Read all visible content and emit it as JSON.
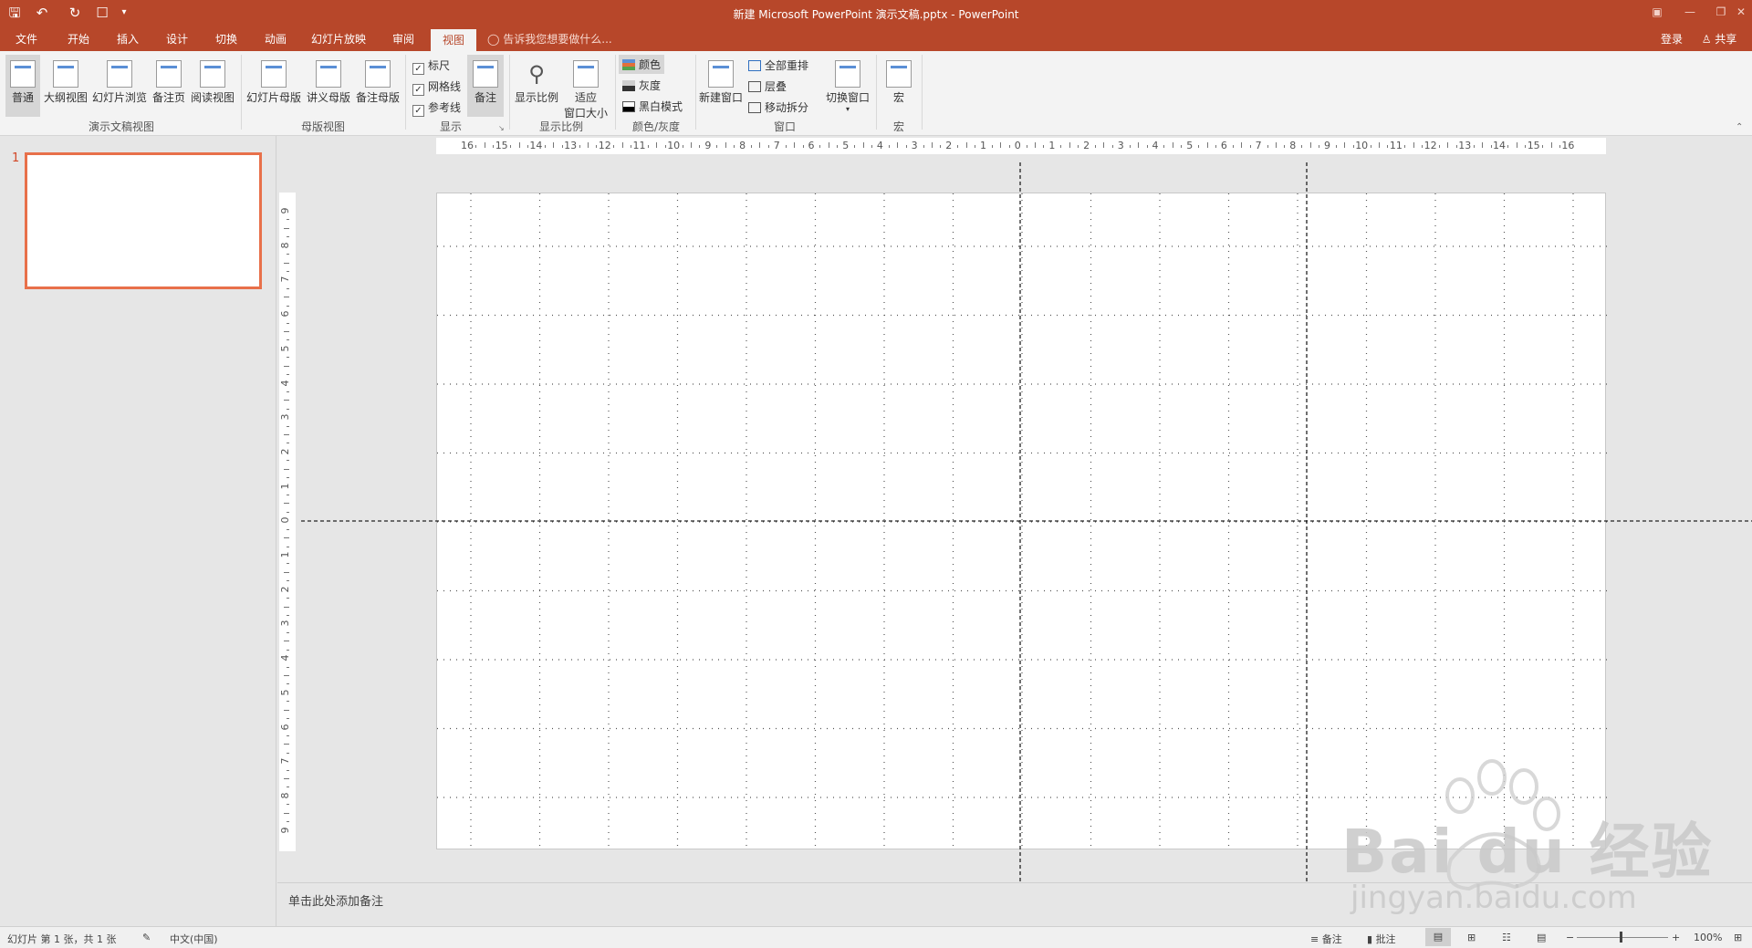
{
  "window": {
    "title": "新建 Microsoft PowerPoint 演示文稿.pptx - PowerPoint"
  },
  "tabs": [
    "文件",
    "开始",
    "插入",
    "设计",
    "切换",
    "动画",
    "幻灯片放映",
    "审阅",
    "视图"
  ],
  "active_tab": "视图",
  "tell_me": "告诉我您想要做什么...",
  "account": {
    "login": "登录",
    "share": "共享"
  },
  "ribbon": {
    "presentation_views": {
      "label": "演示文稿视图",
      "buttons": [
        "普通",
        "大纲视图",
        "幻灯片浏览",
        "备注页",
        "阅读视图"
      ]
    },
    "master_views": {
      "label": "母版视图",
      "buttons": [
        "幻灯片母版",
        "讲义母版",
        "备注母版"
      ]
    },
    "show": {
      "label": "显示",
      "checkboxes": [
        {
          "label": "标尺",
          "checked": true
        },
        {
          "label": "网格线",
          "checked": true
        },
        {
          "label": "参考线",
          "checked": true
        }
      ],
      "notes_button": "备注"
    },
    "zoom": {
      "label": "显示比例",
      "zoom_button": "显示比例",
      "fit_button_line1": "适应",
      "fit_button_line2": "窗口大小"
    },
    "color": {
      "label": "颜色/灰度",
      "items": [
        "颜色",
        "灰度",
        "黑白模式"
      ]
    },
    "window": {
      "label": "窗口",
      "new_window": "新建窗口",
      "items": [
        "全部重排",
        "层叠",
        "移动拆分"
      ],
      "switch": "切换窗口"
    },
    "macros": {
      "label": "宏",
      "button": "宏"
    }
  },
  "thumbnails": {
    "number": "1"
  },
  "hruler_labels": [
    "16",
    "15",
    "14",
    "13",
    "12",
    "11",
    "10",
    "9",
    "8",
    "7",
    "6",
    "5",
    "4",
    "3",
    "2",
    "1",
    "0",
    "1",
    "2",
    "3",
    "4",
    "5",
    "6",
    "7",
    "8",
    "9",
    "10",
    "11",
    "12",
    "13",
    "14",
    "15",
    "16"
  ],
  "vruler_labels": [
    "9",
    "8",
    "7",
    "6",
    "5",
    "4",
    "3",
    "2",
    "1",
    "0",
    "1",
    "2",
    "3",
    "4",
    "5",
    "6",
    "7",
    "8",
    "9"
  ],
  "notes_placeholder": "单击此处添加备注",
  "status": {
    "slide_info": "幻灯片 第 1 张，共 1 张",
    "language": "中文(中国)",
    "notes": "备注",
    "comments": "批注",
    "zoom": "100%"
  },
  "watermark": {
    "brand": "Bai du 经验",
    "url": "jingyan.baidu.com"
  },
  "colors": {
    "accent": "#b7472a",
    "thumb_border": "#e8704a"
  }
}
